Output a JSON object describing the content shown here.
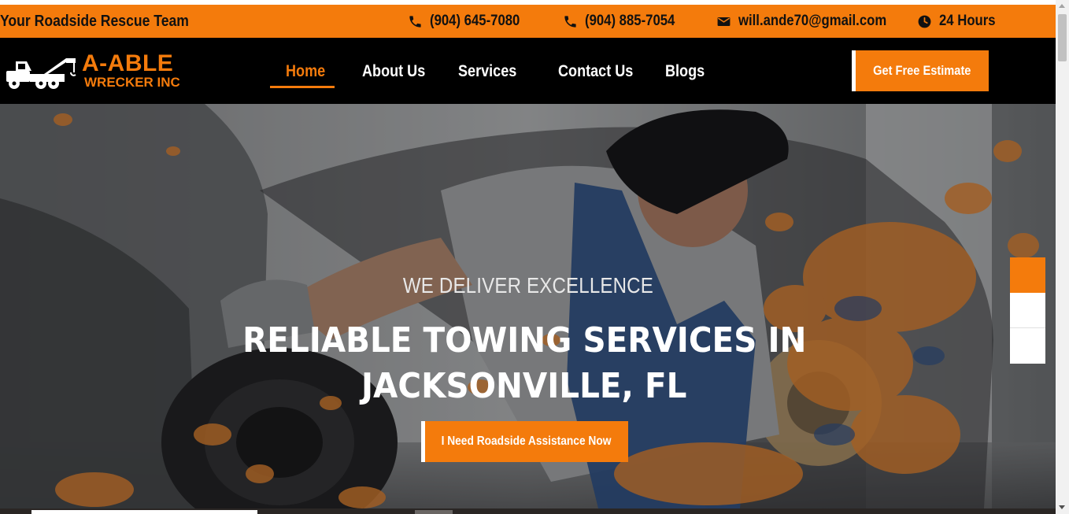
{
  "topbar": {
    "tagline": "Your Roadside Rescue Team",
    "phone_1": "(904) 645-7080",
    "phone_2": "(904) 885-7054",
    "email": "will.ande70@gmail.com",
    "hours": "24 Hours",
    "icons": [
      "phone-icon",
      "phone-icon",
      "envelope-icon",
      "clock-icon"
    ]
  },
  "logo": {
    "line1": "A-ABLE",
    "line2": "WRECKER INC",
    "icon": "tow-truck-icon"
  },
  "nav": {
    "items": [
      {
        "label": "Home",
        "active": true
      },
      {
        "label": "About Us",
        "active": false
      },
      {
        "label": "Services",
        "active": false
      },
      {
        "label": "Contact Us",
        "active": false
      },
      {
        "label": "Blogs",
        "active": false
      }
    ],
    "cta_label": "Get Free Estimate"
  },
  "hero": {
    "kicker": "WE DELIVER EXCELLENCE",
    "headline_line1": "RELIABLE TOWING SERVICES IN",
    "headline_line2": "JACKSONVILLE, FL",
    "cta_label": "I Need Roadside Assistance Now"
  },
  "colors": {
    "accent": "#f47b0c",
    "nav_background": "#000000",
    "text_light": "#ffffff"
  }
}
